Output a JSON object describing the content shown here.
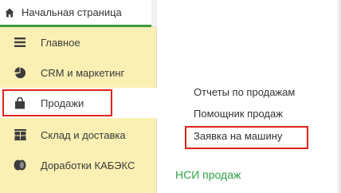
{
  "home_tab": {
    "icon": "home-icon",
    "label": "Начальная страница"
  },
  "sidebar": {
    "items": [
      {
        "icon": "menu-lines-icon",
        "label": "Главное",
        "active": false
      },
      {
        "icon": "pie-chart-icon",
        "label": "CRM и маркетинг",
        "active": false
      },
      {
        "icon": "shopping-bag-icon",
        "label": "Продажи",
        "active": true
      },
      {
        "icon": "warehouse-icon",
        "label": "Склад и доставка",
        "active": false
      },
      {
        "icon": "coins-icon",
        "label": "Доработки КАБЭКС",
        "active": false
      }
    ]
  },
  "content": {
    "links": [
      {
        "label": "Отчеты по продажам"
      },
      {
        "label": "Помощник продаж"
      },
      {
        "label": "Заявка на машину",
        "highlighted": true
      }
    ],
    "section_title": "НСИ продаж"
  },
  "colors": {
    "sidebar_bg": "#faf0b4",
    "highlight_border": "#e32119",
    "section_title": "#2fa14a",
    "active_tab_underline": "#3c9a3c"
  }
}
